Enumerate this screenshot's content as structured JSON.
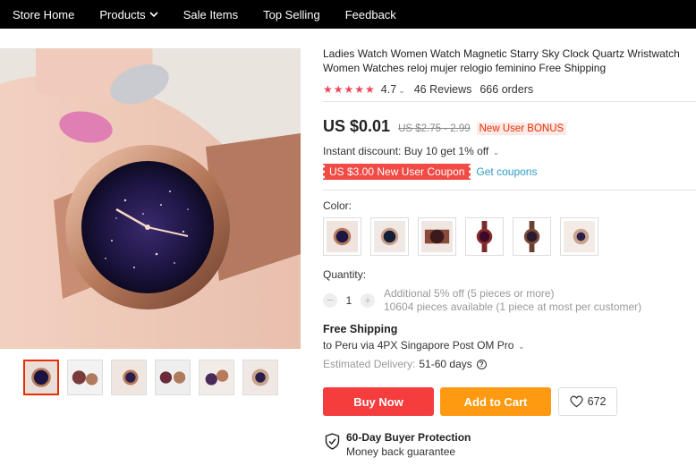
{
  "nav": {
    "items": [
      "Store Home",
      "Products",
      "Sale Items",
      "Top Selling",
      "Feedback"
    ]
  },
  "product": {
    "title": "Ladies Watch Women Watch Magnetic Starry Sky Clock Quartz Wristwatch Women Watches reloj mujer relogio feminino Free Shipping",
    "stars": "★★★★★",
    "rating": "4.7",
    "reviews": "46 Reviews",
    "orders": "666 orders"
  },
  "price": {
    "current": "US $0.01",
    "original": "US $2.75 - 2.99",
    "bonus": "New User BONUS"
  },
  "discount": {
    "instant": "Instant discount: Buy 10 get 1% off",
    "coupon": "US $3.00 New User Coupon",
    "get_coupons": "Get coupons"
  },
  "color": {
    "label": "Color:",
    "swatch_count": 6
  },
  "quantity": {
    "label": "Quantity:",
    "value": "1",
    "minus": "−",
    "plus": "+",
    "line1": "Additional 5% off (5 pieces or more)",
    "line2": "10604 pieces available (1 piece at most per customer)"
  },
  "shipping": {
    "title": "Free Shipping",
    "to": "to Peru via 4PX Singapore Post OM Pro",
    "delivery_label": "Estimated Delivery:",
    "delivery_value": "51-60 days",
    "help_icon": "question-icon"
  },
  "actions": {
    "buy": "Buy Now",
    "cart": "Add to Cart",
    "wishlist_count": "672"
  },
  "protection": {
    "title": "60-Day Buyer Protection",
    "subtitle": "Money back guarantee"
  },
  "colors": {
    "nav_bg": "#000000",
    "buy_now": "#f53d3d",
    "add_to_cart": "#fe9a12",
    "coupon": "#f14b45",
    "stars": "#f0465a",
    "link": "#2e9cc3"
  }
}
